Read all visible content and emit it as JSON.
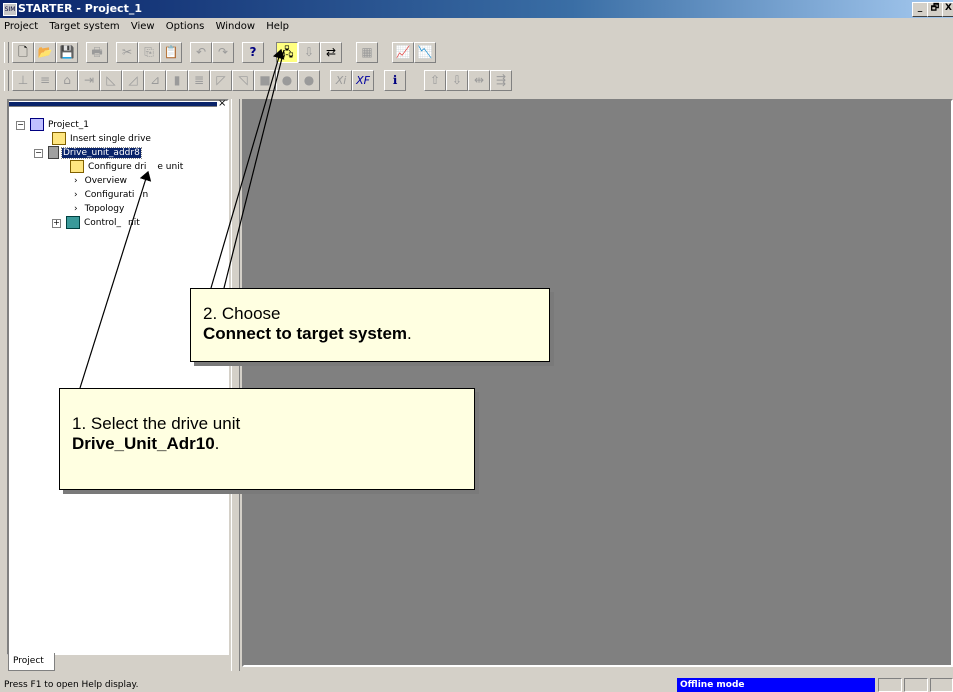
{
  "window": {
    "title": "STARTER - Project_1",
    "app_icon_text": "SIM",
    "minimize": "_",
    "restore": "🗗",
    "close": "X"
  },
  "menu": [
    "Project",
    "Target system",
    "View",
    "Options",
    "Window",
    "Help"
  ],
  "toolbar1": [
    {
      "name": "new-icon",
      "glyph": "🗋",
      "enabled": true
    },
    {
      "name": "open-icon",
      "glyph": "📂",
      "enabled": true
    },
    {
      "name": "save-icon",
      "glyph": "💾",
      "enabled": true
    },
    {
      "name": "print-icon",
      "glyph": "🖶",
      "enabled": false
    },
    {
      "name": "cut-icon",
      "glyph": "✂",
      "enabled": false
    },
    {
      "name": "copy-icon",
      "glyph": "⎘",
      "enabled": false
    },
    {
      "name": "paste-icon",
      "glyph": "📋",
      "enabled": false
    },
    {
      "name": "undo-icon",
      "glyph": "↶",
      "enabled": false
    },
    {
      "name": "redo-icon",
      "glyph": "↷",
      "enabled": false
    },
    {
      "name": "help-icon",
      "glyph": "?",
      "enabled": true
    },
    {
      "name": "connect-target-icon",
      "glyph": "🖧",
      "enabled": true
    },
    {
      "name": "load-icon",
      "glyph": "⇩",
      "enabled": false
    },
    {
      "name": "online-offline-icon",
      "glyph": "⇄",
      "enabled": true
    },
    {
      "name": "network-icon",
      "glyph": "▦",
      "enabled": false
    },
    {
      "name": "trace-icon",
      "glyph": "📈",
      "enabled": true
    },
    {
      "name": "measure-icon",
      "glyph": "📉",
      "enabled": true
    }
  ],
  "toolbar2": [
    {
      "name": "block-1-icon",
      "glyph": "⊥"
    },
    {
      "name": "block-2-icon",
      "glyph": "≡"
    },
    {
      "name": "block-3-icon",
      "glyph": "⌂"
    },
    {
      "name": "block-4-icon",
      "glyph": "⇥"
    },
    {
      "name": "block-5-icon",
      "glyph": "◺"
    },
    {
      "name": "block-6-icon",
      "glyph": "◿"
    },
    {
      "name": "block-7-icon",
      "glyph": "⊿"
    },
    {
      "name": "block-8-icon",
      "glyph": "▮"
    },
    {
      "name": "block-9-icon",
      "glyph": "≣"
    },
    {
      "name": "block-10-icon",
      "glyph": "◸"
    },
    {
      "name": "block-11-icon",
      "glyph": "◹"
    },
    {
      "name": "stop-icon",
      "glyph": "■"
    },
    {
      "name": "record-icon",
      "glyph": "●"
    },
    {
      "name": "pause-icon",
      "glyph": "●"
    },
    {
      "name": "xi-icon",
      "glyph": "Xi"
    },
    {
      "name": "xf-icon",
      "glyph": "XF"
    },
    {
      "name": "info-icon",
      "glyph": "ℹ"
    },
    {
      "name": "upload-icon",
      "glyph": "⇧"
    },
    {
      "name": "download-icon",
      "glyph": "⇩"
    },
    {
      "name": "compare-icon",
      "glyph": "⇹"
    },
    {
      "name": "copy-ram-icon",
      "glyph": "⇶"
    }
  ],
  "tree": {
    "root": "Project_1",
    "insert_single_drive": "Insert single drive",
    "drive_unit": "Drive_unit_addr8",
    "configure": "Configure dri",
    "configure_tail": "e unit",
    "overview": "Overview",
    "configuration": "Configurati",
    "configuration_tail": "n",
    "topology": "Topology",
    "control_unit": "Control_",
    "control_unit_tail": "nit"
  },
  "panel_tab": "Project",
  "status": {
    "help_text": "Press F1 to open Help display.",
    "mode": "Offline mode",
    "mode_color": "#0000ff"
  },
  "callouts": {
    "step2_line1": "2. Choose",
    "step2_bold": "Connect to target system",
    "step2_tail": ".",
    "step1_line1": "1. Select the drive unit",
    "step1_bold": "Drive_Unit_Adr10",
    "step1_tail": "."
  }
}
